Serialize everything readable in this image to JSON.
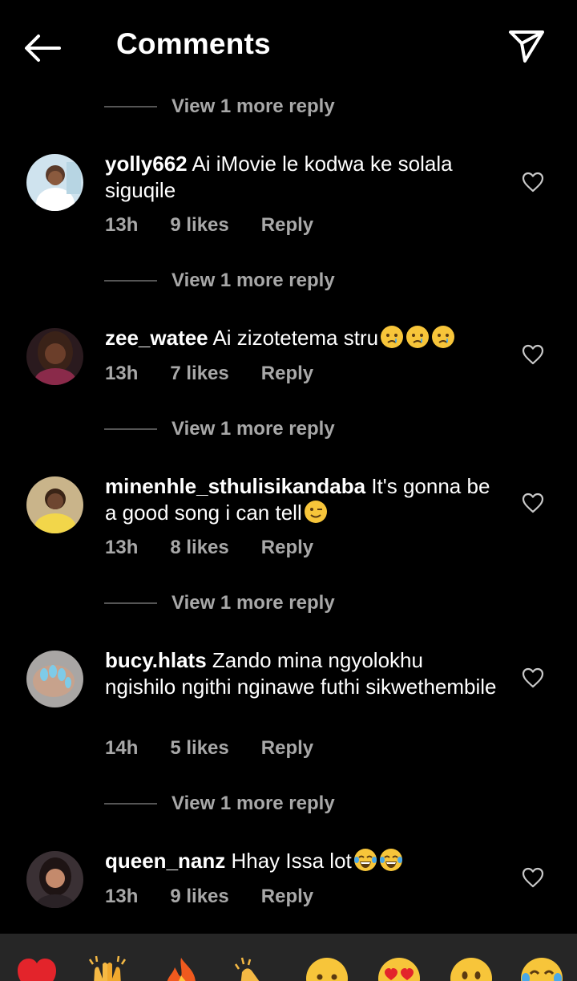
{
  "header": {
    "title": "Comments"
  },
  "view_more_label": "View 1 more reply",
  "comments": [
    {
      "username": "yolly662",
      "text": "Ai iMovie le kodwa ke solala siguqile",
      "time": "13h",
      "likes": "9 likes",
      "reply": "Reply"
    },
    {
      "username": "zee_watee",
      "text": "Ai zizotetema stru",
      "time": "13h",
      "likes": "7 likes",
      "reply": "Reply"
    },
    {
      "username": "minenhle_sthulisikandaba",
      "text": "It's gonna be a good song i can tell",
      "time": "13h",
      "likes": "8 likes",
      "reply": "Reply"
    },
    {
      "username": "bucy.hlats",
      "text": "Zando mina ngyolokhu ngishilo ngithi nginawe futhi sikwethembile",
      "time": "14h",
      "likes": "5 likes",
      "reply": "Reply"
    },
    {
      "username": "queen_nanz",
      "text": "Hhay Issa lot",
      "time": "13h",
      "likes": "9 likes",
      "reply": "Reply"
    }
  ],
  "reactions": [
    "red-heart",
    "raising-hands",
    "fire",
    "clapping-hands",
    "crying-face",
    "heart-eyes-face",
    "surprised-face",
    "tears-of-joy-face"
  ],
  "colors": {
    "background": "#000000",
    "secondary_text": "#a8a8a8",
    "reaction_bar": "#262626"
  }
}
